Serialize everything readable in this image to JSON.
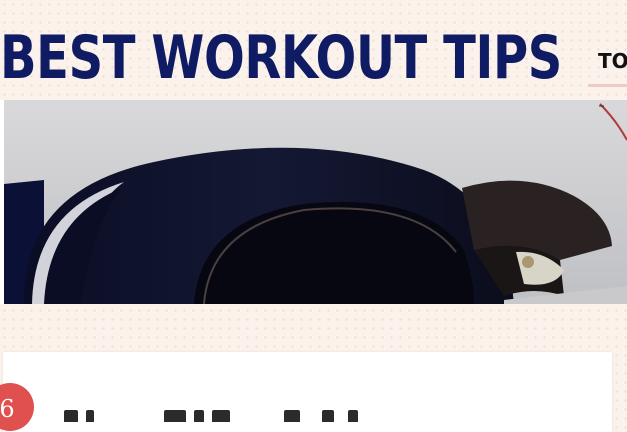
{
  "header": {
    "site_title": "BEST WORKOUT TIPS",
    "nav": {
      "top_label": "TOP"
    }
  },
  "hero": {
    "image": "headphones-closeup"
  },
  "post": {
    "rank": "6"
  },
  "colors": {
    "title": "#0f1c63",
    "page_background": "#fbf2ec",
    "rank_badge": "#e0504f",
    "nav_underline": "#f2c9c9"
  }
}
